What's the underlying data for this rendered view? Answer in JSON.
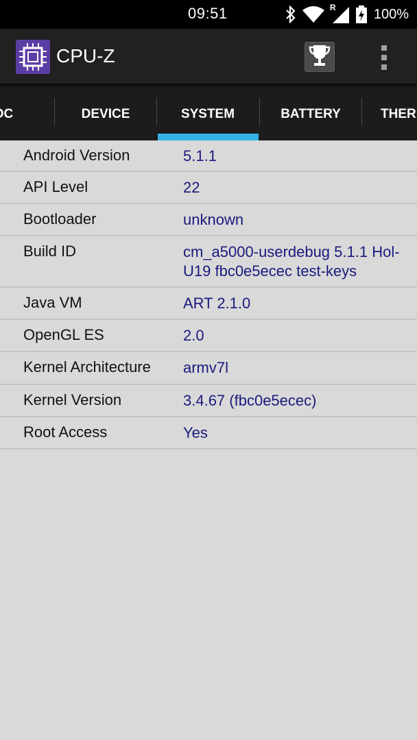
{
  "status_bar": {
    "time": "09:51",
    "network_badge": "R",
    "battery": "100%"
  },
  "app_bar": {
    "title": "CPU-Z",
    "logo_icon": "cpu-chip-icon",
    "trophy_icon": "trophy-icon",
    "menu_icon": "overflow-menu-icon"
  },
  "tabs": [
    {
      "label": "OC"
    },
    {
      "label": "DEVICE"
    },
    {
      "label": "SYSTEM",
      "selected": true
    },
    {
      "label": "BATTERY"
    },
    {
      "label": "THER"
    }
  ],
  "rows": [
    {
      "label": "Android Version",
      "value": "5.1.1"
    },
    {
      "label": "API Level",
      "value": "22"
    },
    {
      "label": "Bootloader",
      "value": "unknown"
    },
    {
      "label": "Build ID",
      "value": "cm_a5000-userdebug 5.1.1 Hol-U19 fbc0e5ecec test-keys"
    },
    {
      "label": "Java VM",
      "value": "ART 2.1.0"
    },
    {
      "label": "OpenGL ES",
      "value": "2.0"
    },
    {
      "label": "Kernel Architecture",
      "value": "armv7l"
    },
    {
      "label": "Kernel Version",
      "value": "3.4.67 (fbc0e5ecec)"
    },
    {
      "label": "Root Access",
      "value": "Yes"
    }
  ],
  "colors": {
    "accent": "#36b1e6",
    "value_text": "#1a1a7e",
    "background": "#d9d9d9"
  }
}
